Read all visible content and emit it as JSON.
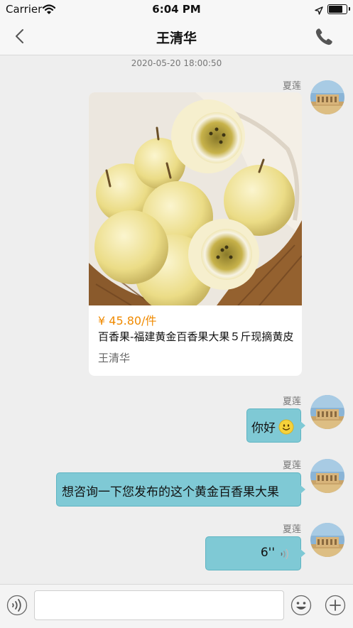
{
  "status_bar": {
    "carrier": "Carrier",
    "time": "6:04 PM",
    "battery_level": 0.85
  },
  "nav": {
    "title": "王清华",
    "back_icon": "chevron-left-icon",
    "call_icon": "phone-icon"
  },
  "chat": {
    "timestamp": "2020-05-20 18:00:50",
    "messages": [
      {
        "type": "product",
        "sender": "夏莲",
        "product": {
          "price": "¥ 45.80/件",
          "title": "百香果-福建黄金百香果大果５斤现摘黄皮",
          "seller": "王清华"
        }
      },
      {
        "type": "text",
        "sender": "夏莲",
        "text": "你好",
        "emoji": "smiley-icon"
      },
      {
        "type": "text",
        "sender": "夏莲",
        "text": "想咨询一下您发布的这个黄金百香果大果"
      },
      {
        "type": "voice",
        "sender": "夏莲",
        "duration": "6''"
      }
    ]
  },
  "input_bar": {
    "placeholder": "",
    "voice_icon": "voice-icon",
    "emoji_icon": "emoji-icon",
    "plus_icon": "plus-icon"
  },
  "colors": {
    "bubble": "#7fc9d5",
    "price": "#f08a00",
    "background": "#eeeeee"
  }
}
